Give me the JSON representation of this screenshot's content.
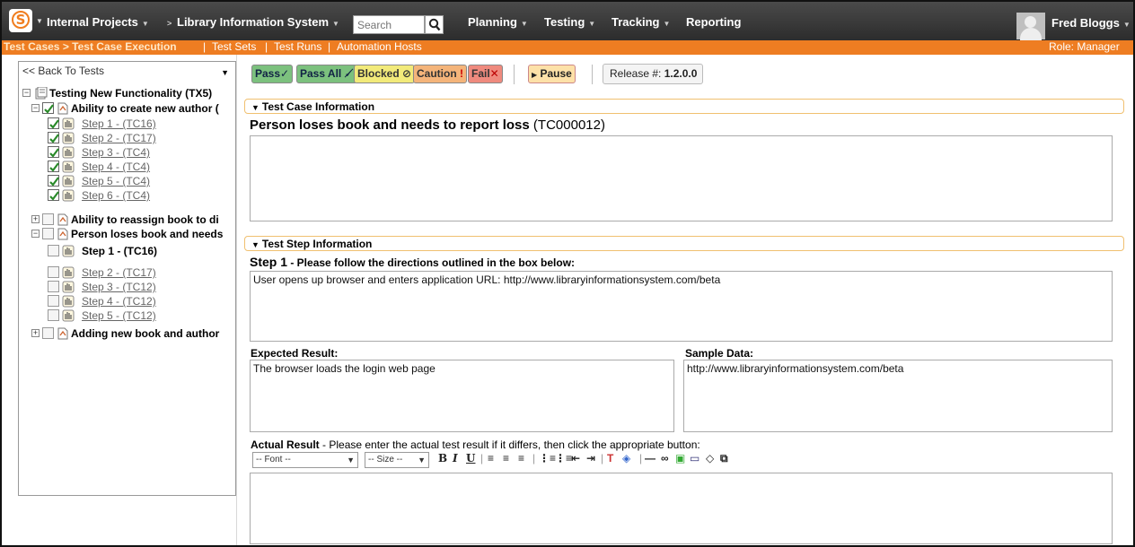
{
  "topbar": {
    "logo_letter": "S",
    "nav": [
      {
        "label": "Internal Projects"
      },
      {
        "label": "Library Information System"
      }
    ],
    "separator": "> ",
    "search_placeholder": "Search",
    "menus": [
      {
        "label": "Planning"
      },
      {
        "label": "Testing"
      },
      {
        "label": "Tracking"
      },
      {
        "label": "Reporting"
      }
    ],
    "user": "Fred Bloggs"
  },
  "subbar": {
    "items": [
      "Test Cases > Test Case Execution",
      "Test Sets",
      "Test Runs",
      "Automation Hosts"
    ],
    "separator": "|",
    "role": "Role: Manager"
  },
  "tree": {
    "back_label": "<< Back To Tests",
    "rows": [
      {
        "label": "Testing New Functionality (TX5)"
      },
      {
        "label": "Ability to create new author ("
      },
      {
        "label": "Step 1 - (TC16)"
      },
      {
        "label": "Step 2 - (TC17)"
      },
      {
        "label": "Step 3 - (TC4)"
      },
      {
        "label": "Step 4 - (TC4)"
      },
      {
        "label": "Step 5 - (TC4)"
      },
      {
        "label": "Step 6 - (TC4)"
      },
      {
        "label": "Ability to reassign book to di"
      },
      {
        "label": "Person loses book and needs"
      },
      {
        "label": "Step 1 - (TC16)"
      },
      {
        "label": "Step 2 - (TC17)"
      },
      {
        "label": "Step 3 - (TC12)"
      },
      {
        "label": "Step 4 - (TC12)"
      },
      {
        "label": "Step 5 - (TC12)"
      },
      {
        "label": "Adding new book and author"
      }
    ]
  },
  "toolbar": {
    "pass": "Pass",
    "pass_all": "Pass All",
    "blocked": "Blocked",
    "caution": "Caution",
    "fail": "Fail",
    "pause": "Pause",
    "release_label": "Release #:",
    "release_value": "1.2.0.0"
  },
  "test_case": {
    "section_title": "Test Case Information",
    "name": "Person loses book and needs to report loss",
    "id": "(TC000012)"
  },
  "test_step": {
    "section_title": "Test Step Information",
    "step_label": "Step 1",
    "step_instructions": " - Please follow the directions outlined in the box below:",
    "description": "User opens up browser and enters application URL: http://www.libraryinformationsystem.com/beta",
    "expected_label": "Expected Result:",
    "expected_value": "The browser loads the login web page",
    "sample_label": "Sample Data:",
    "sample_value": "http://www.libraryinformationsystem.com/beta",
    "actual_label": "Actual Result",
    "actual_instructions": " - Please enter the actual test result if it differs, then click the appropriate button:"
  },
  "editor": {
    "font_select": "-- Font --",
    "size_select": "-- Size --"
  }
}
